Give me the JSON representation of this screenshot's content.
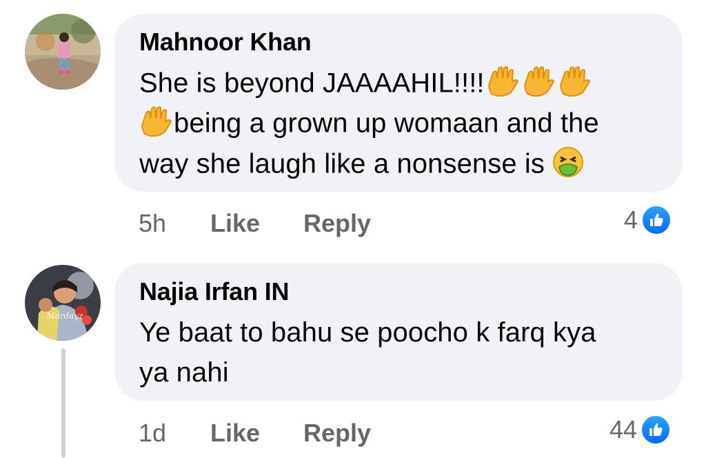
{
  "comments": [
    {
      "author": "Mahnoor Khan",
      "lines": [
        "She is beyond JAAAAHIL!!!!",
        "being a grown up womaan and the",
        "way she laugh like a nonsense is"
      ],
      "time": "5h",
      "like_label": "Like",
      "reply_label": "Reply",
      "reaction_count": "4",
      "reaction_icon": "like-icon",
      "emojis": [
        "raised-hand-icon",
        "raised-hand-icon",
        "raised-hand-icon",
        "raised-hand-icon",
        "nauseated-face-icon"
      ]
    },
    {
      "author": "Najia Irfan IN",
      "lines": [
        "Ye baat to bahu se poocho k farq kya",
        "ya nahi"
      ],
      "time": "1d",
      "like_label": "Like",
      "reply_label": "Reply",
      "reaction_count": "44",
      "reaction_icon": "like-icon"
    }
  ],
  "colors": {
    "bubble": "#f0f2f5",
    "text": "#050505",
    "secondary": "#65676b",
    "like_blue": "#0866ff",
    "thread_line": "#ced0d4"
  }
}
